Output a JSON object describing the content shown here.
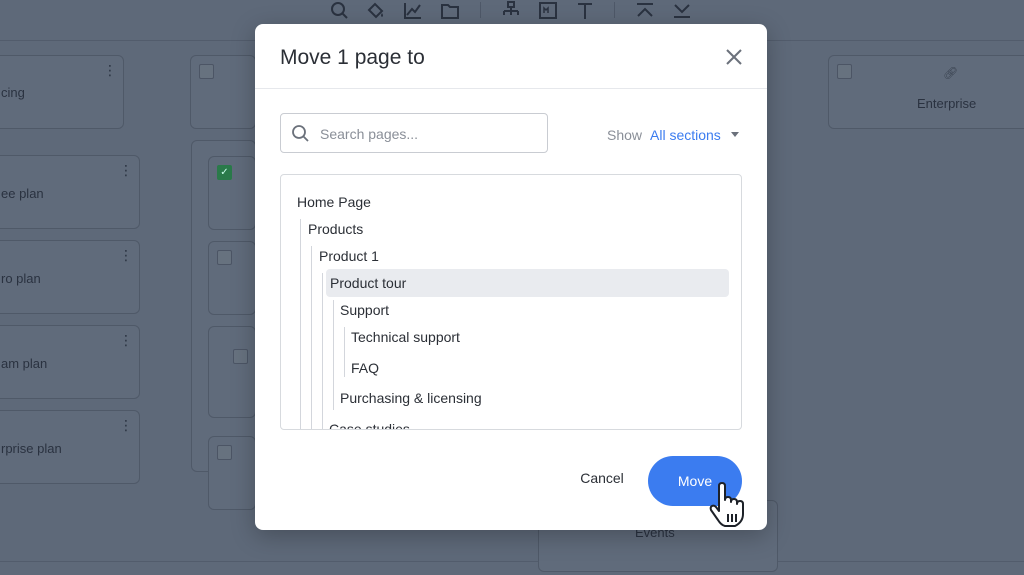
{
  "background": {
    "cards": [
      {
        "label": "cing"
      },
      {
        "label": "ee plan"
      },
      {
        "label": "ro plan"
      },
      {
        "label": "am plan"
      },
      {
        "label": "rprise plan"
      },
      {
        "label": "Enterprise"
      },
      {
        "label": "Events"
      }
    ]
  },
  "toolbar": {
    "icons": [
      "search-icon",
      "paint-bucket-icon",
      "chart-icon",
      "folder-icon",
      "sitemap-icon",
      "markdown-icon",
      "text-icon",
      "collapse-up-icon",
      "collapse-down-icon"
    ]
  },
  "modal": {
    "title": "Move 1 page to",
    "search": {
      "placeholder": "Search pages...",
      "value": ""
    },
    "show_label": "Show",
    "section_filter": "All sections",
    "tree": [
      {
        "label": "Home Page",
        "depth": 0,
        "selected": false
      },
      {
        "label": "Products",
        "depth": 1,
        "selected": false
      },
      {
        "label": "Product 1",
        "depth": 2,
        "selected": false
      },
      {
        "label": "Product tour",
        "depth": 3,
        "selected": true
      },
      {
        "label": "Support",
        "depth": 4,
        "selected": false
      },
      {
        "label": "Technical support",
        "depth": 5,
        "selected": false
      },
      {
        "label": "FAQ",
        "depth": 5,
        "selected": false
      },
      {
        "label": "Purchasing & licensing",
        "depth": 4,
        "selected": false
      },
      {
        "label": "Case studies",
        "depth": 3,
        "selected": false
      }
    ],
    "cancel_label": "Cancel",
    "move_label": "Move"
  },
  "colors": {
    "accent": "#3b7cf0",
    "overlay": "#5e6979",
    "selected_row": "#e9ebef"
  }
}
